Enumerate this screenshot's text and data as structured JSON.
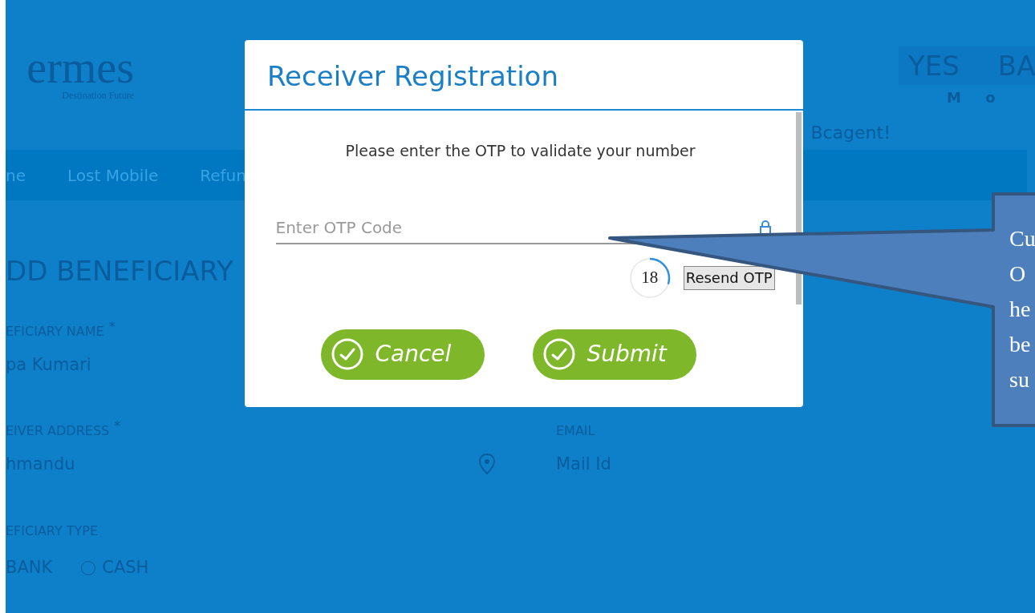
{
  "background_page": {
    "logo": {
      "name": "ermes",
      "tagline": "Destination Future"
    },
    "bank_logo": {
      "left": "YES",
      "right": "BA",
      "subtitle": "M o"
    },
    "greeting": "Bcagent!",
    "nav": [
      "ne",
      "Lost Mobile",
      "Refun"
    ],
    "heading": "DD BENEFICIARY",
    "name_field": {
      "label": "EFICIARY NAME",
      "required_mark": "*",
      "value": "pa Kumari"
    },
    "address_field": {
      "label": "EIVER ADDRESS",
      "required_mark": "*",
      "value": "hmandu"
    },
    "email_field": {
      "label": "EMAIL",
      "placeholder": "Mail Id"
    },
    "type_field": {
      "label": "EFICIARY TYPE",
      "options": [
        {
          "label": "BANK"
        },
        {
          "label": "CASH",
          "selected": false
        }
      ]
    }
  },
  "modal": {
    "title": "Receiver Registration",
    "message": "Please enter the OTP to validate your number",
    "otp_field": {
      "placeholder": "Enter OTP Code"
    },
    "timer": {
      "reading": "18"
    },
    "resend_button": "Resend OTP",
    "buttons": [
      "Cancel",
      "Submit"
    ]
  },
  "callout": {
    "lines": [
      "Cu",
      "O",
      "he",
      "be",
      "su"
    ]
  }
}
